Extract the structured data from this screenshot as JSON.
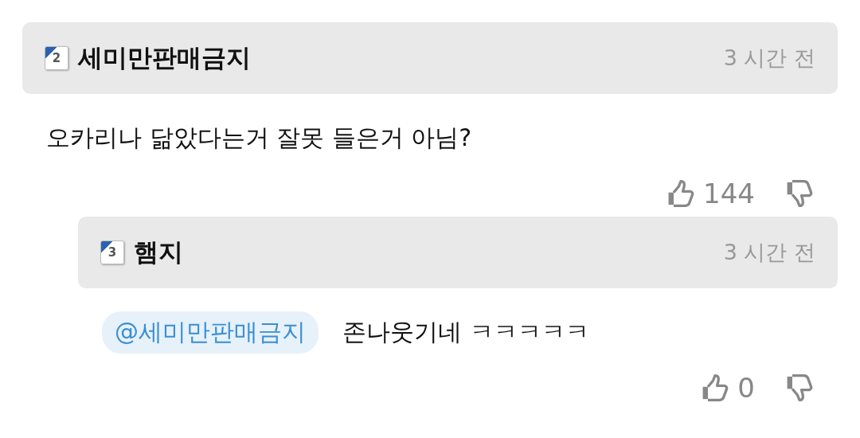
{
  "comments": [
    {
      "reply": false,
      "level": "2",
      "author": "세미만판매금지",
      "time": "3 시간 전",
      "body": "오카리나 닮았다는거 잘못 들은거 아님?",
      "likes": "144"
    },
    {
      "reply": true,
      "level": "3",
      "author": "햄지",
      "time": "3 시간 전",
      "mention": "@세미만판매금지",
      "body": "존나웃기네 ㅋㅋㅋㅋㅋ",
      "likes": "0"
    }
  ]
}
